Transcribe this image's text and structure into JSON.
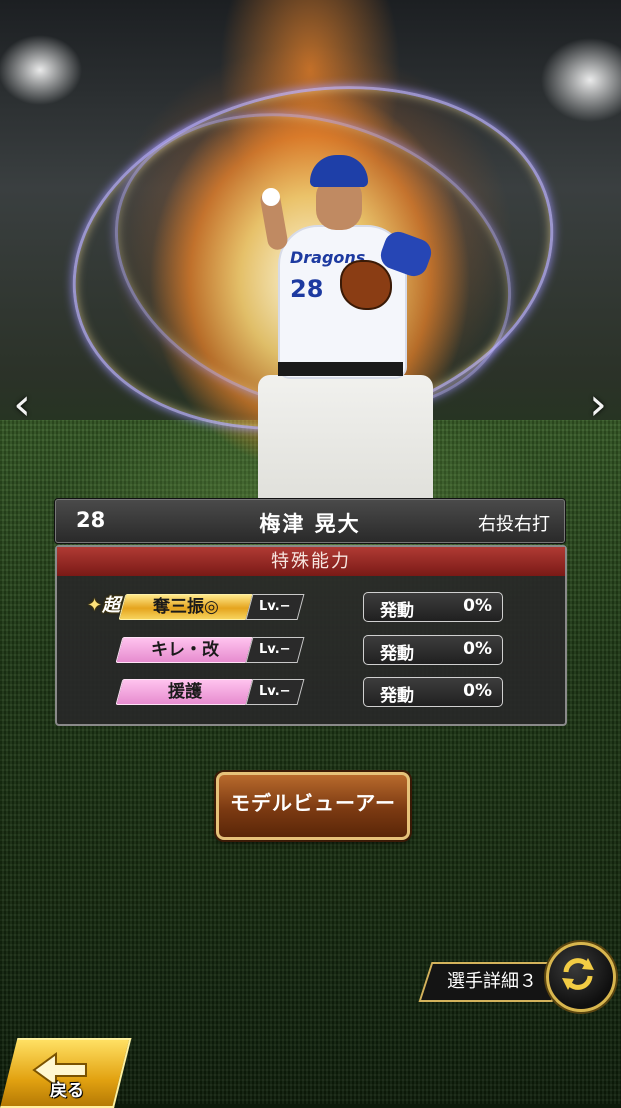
{
  "player": {
    "number": "28",
    "name": "梅津 晃大",
    "handedness": "右投右打",
    "uniform_number": "28",
    "uniform_logo": "Dragons"
  },
  "abilities_panel": {
    "title": "特殊能力",
    "abilities": [
      {
        "super_mark": "超",
        "name": "奪三振◎",
        "level": "Lv.−",
        "trigger_label": "発動",
        "trigger_value": "0%",
        "tier": "gold"
      },
      {
        "name": "キレ・改",
        "level": "Lv.−",
        "trigger_label": "発動",
        "trigger_value": "0%",
        "tier": "pink"
      },
      {
        "name": "援護",
        "level": "Lv.−",
        "trigger_label": "発動",
        "trigger_value": "0%",
        "tier": "pink"
      }
    ]
  },
  "buttons": {
    "model_viewer": "モデルビューアー",
    "player_detail": "選手詳細３",
    "back": "戻る"
  },
  "nav": {
    "prev_icon": "‹",
    "next_icon": "›"
  },
  "colors": {
    "gold_ability": "#e5a41e",
    "pink_ability": "#e78ccf",
    "panel_header": "#b03a34",
    "button_brown": "#7c3a12"
  }
}
